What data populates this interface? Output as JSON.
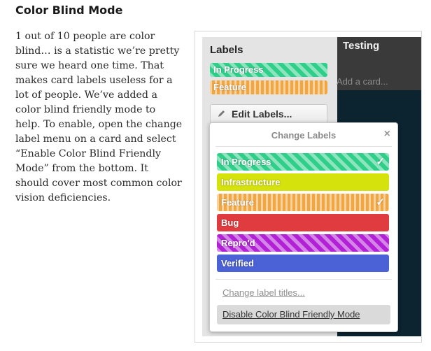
{
  "article": {
    "heading": "Color Blind Mode",
    "paragraph": "1 out of 10 people are color blind… is a statistic we’re pretty sure we heard one time. That makes card labels useless for a lot of people. We’ve added a color blind friendly mode to help. To enable, open the change label menu on a card and select “Enable Color Blind Friendly Mode” from the bottom. It should cover most common color vision deficiencies."
  },
  "card": {
    "labels_title": "Labels",
    "labels": [
      {
        "text": "In Progress",
        "color": "#2fcf8a",
        "pattern": "diagonal-stripes"
      },
      {
        "text": "Feature",
        "color": "#f2a641",
        "pattern": "vertical-stripes"
      }
    ],
    "edit_button": "Edit Labels...",
    "edit_icon": "pencil-icon"
  },
  "list": {
    "title": "Testing",
    "add_card": "Add a card..."
  },
  "popup": {
    "title": "Change Labels",
    "close_icon": "close-icon",
    "close_glyph": "×",
    "labels": [
      {
        "text": "In Progress",
        "color": "#2fcf8a",
        "pattern": "diagonal-stripes",
        "checked": true
      },
      {
        "text": "Infrastructure",
        "color": "#d5e20c",
        "pattern": "solid",
        "checked": false
      },
      {
        "text": "Feature",
        "color": "#f2a641",
        "pattern": "vertical-stripes",
        "checked": true
      },
      {
        "text": "Bug",
        "color": "#e03b3f",
        "pattern": "solid",
        "checked": false
      },
      {
        "text": "Repro'd",
        "color": "#b321d6",
        "pattern": "diagonal-stripes",
        "checked": false
      },
      {
        "text": "Verified",
        "color": "#4b61d6",
        "pattern": "solid",
        "checked": false
      }
    ],
    "check_glyph": "✓",
    "change_titles_link": "Change label titles...",
    "disable_button": "Disable Color Blind Friendly Mode"
  }
}
